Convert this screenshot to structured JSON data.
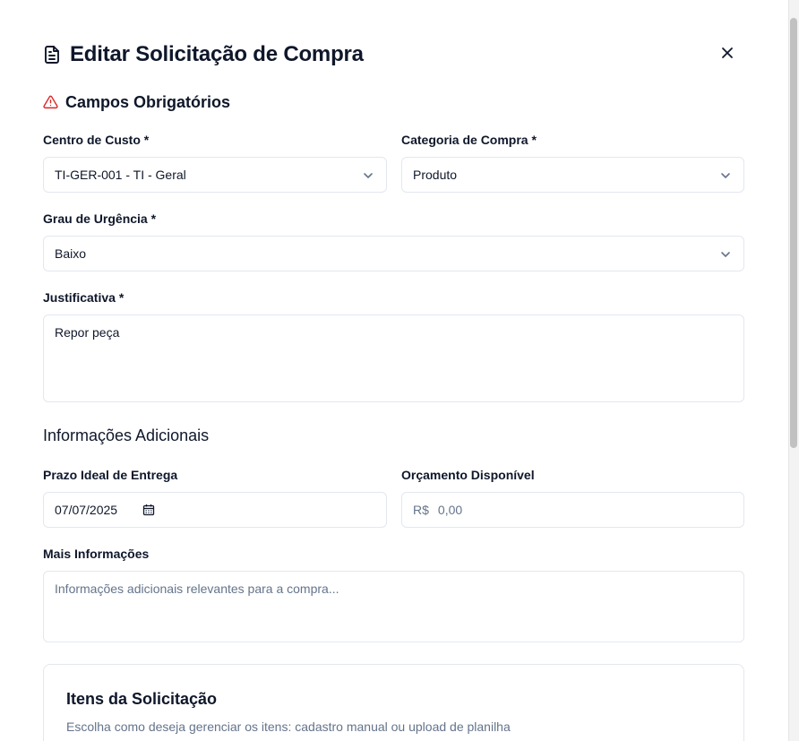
{
  "dialog": {
    "title": "Editar Solicitação de Compra",
    "title_icon": "file-text-icon",
    "close_icon": "close-icon"
  },
  "required_section": {
    "title": "Campos Obrigatórios",
    "icon": "alert-triangle-icon",
    "icon_color": "#dc2626"
  },
  "fields": {
    "centro_custo": {
      "label": "Centro de Custo *",
      "value": "TI-GER-001 - TI - Geral"
    },
    "categoria": {
      "label": "Categoria de Compra *",
      "value": "Produto"
    },
    "urgencia": {
      "label": "Grau de Urgência *",
      "value": "Baixo"
    },
    "justificativa": {
      "label": "Justificativa *",
      "value": "Repor peça"
    }
  },
  "additional_section": {
    "title": "Informações Adicionais",
    "prazo": {
      "label": "Prazo Ideal de Entrega",
      "value": "07/07/2025"
    },
    "orcamento": {
      "label": "Orçamento Disponível",
      "prefix": "R$",
      "placeholder": "0,00"
    },
    "mais_info": {
      "label": "Mais Informações",
      "placeholder": "Informações adicionais relevantes para a compra..."
    }
  },
  "items_card": {
    "title": "Itens da Solicitação",
    "description": "Escolha como deseja gerenciar os itens: cadastro manual ou upload de planilha"
  },
  "colors": {
    "text": "#0f172a",
    "muted": "#64748b",
    "border": "#e2e8f0",
    "warning": "#dc2626"
  }
}
